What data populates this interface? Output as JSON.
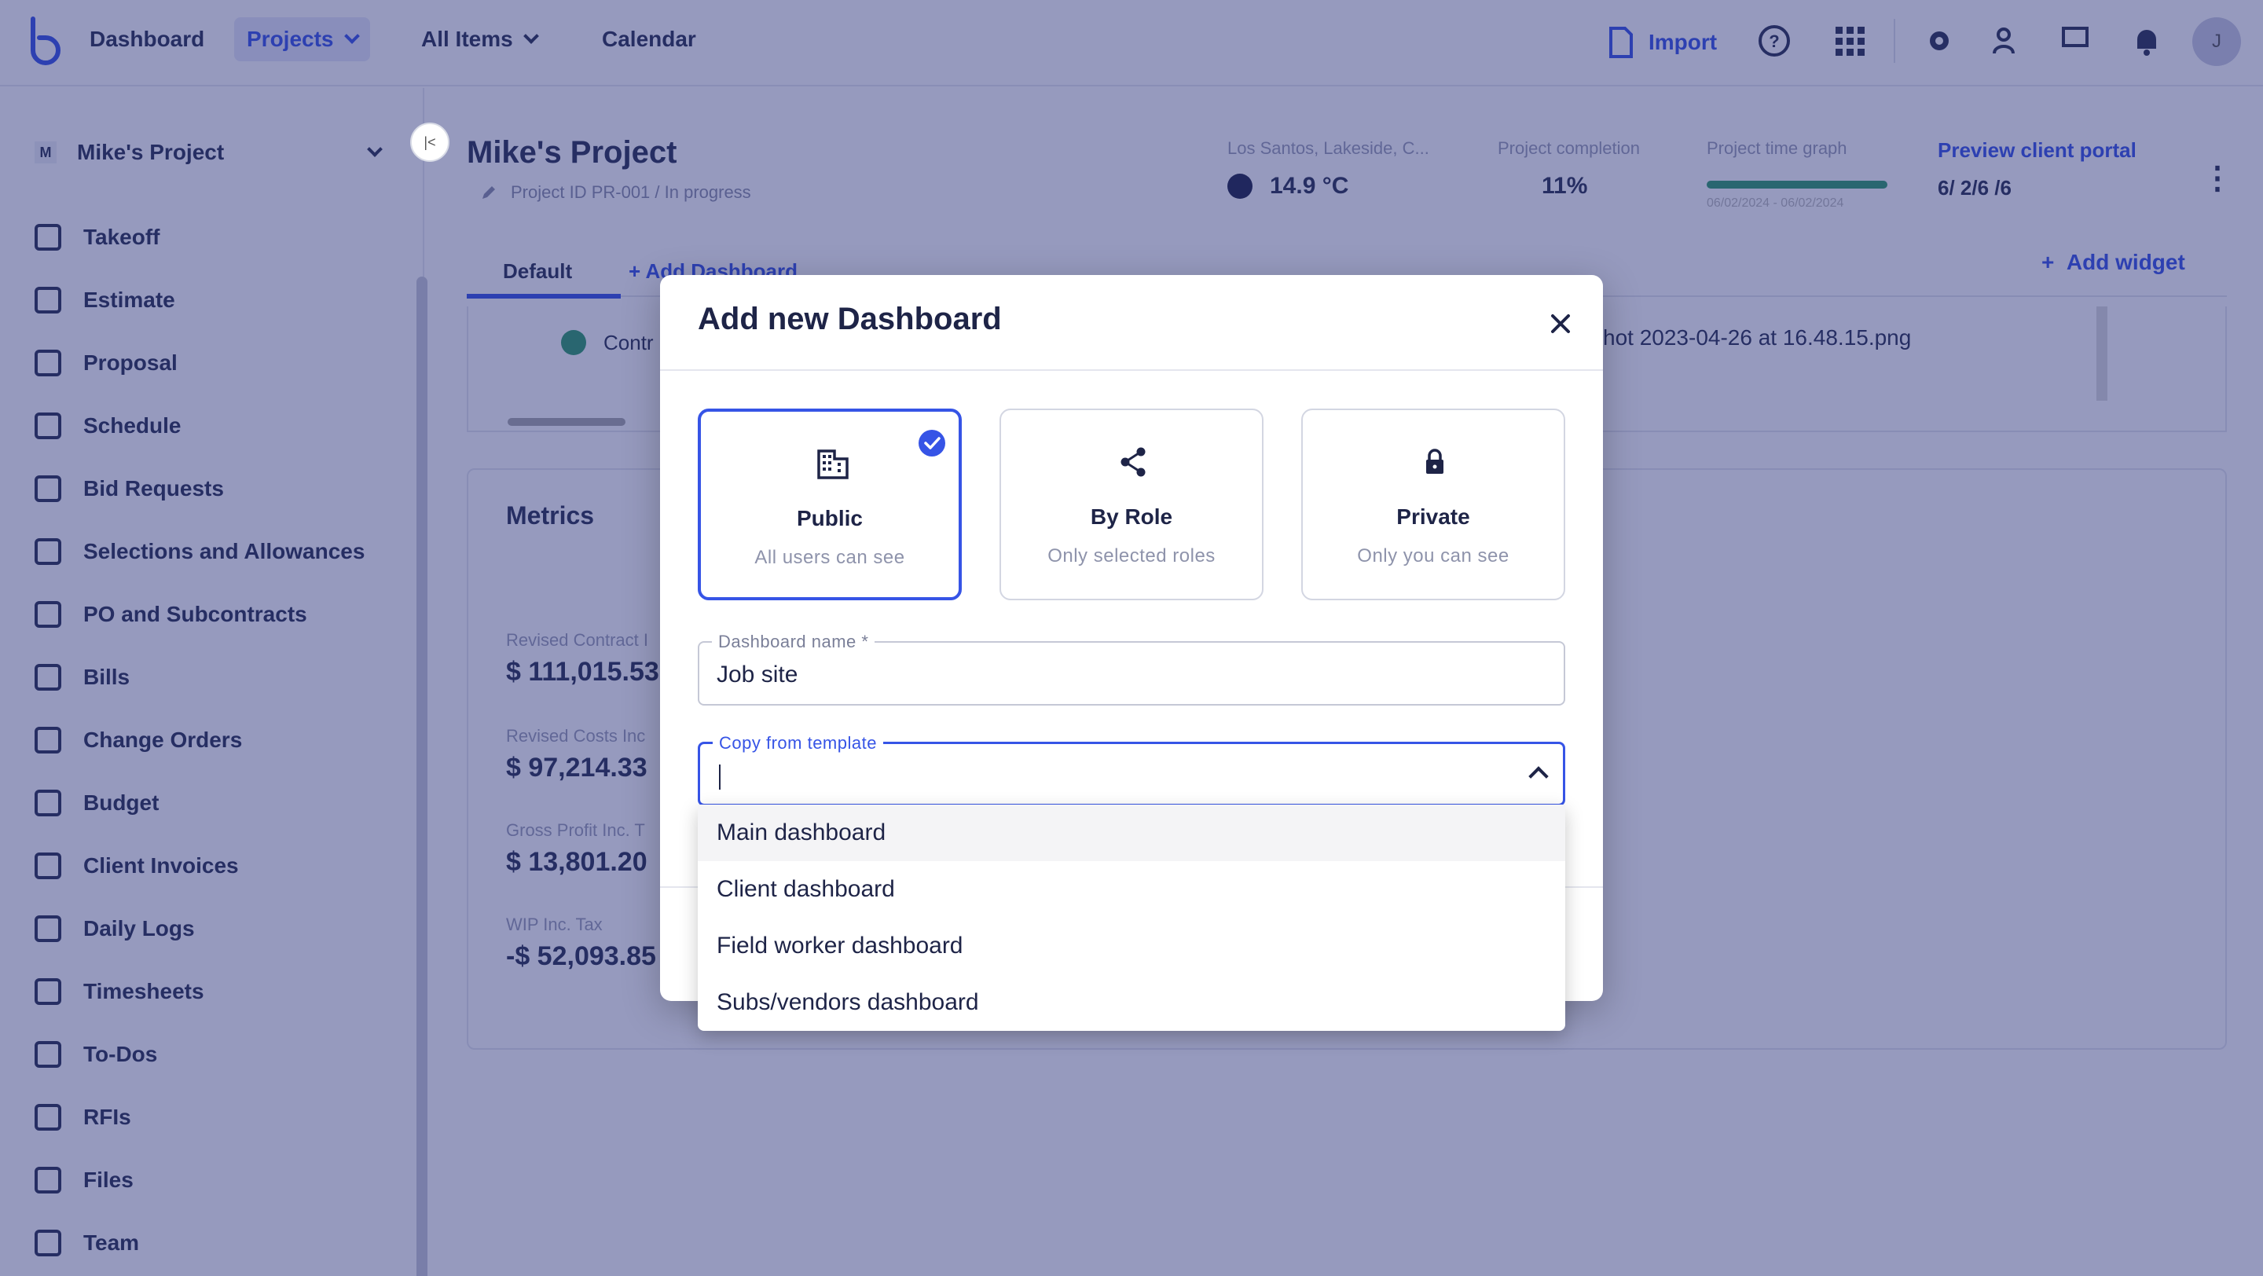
{
  "topbar": {
    "nav": [
      "Dashboard",
      "Projects",
      "All Items",
      "Calendar"
    ],
    "import_label": "Import",
    "avatar_initial": "J"
  },
  "sidebar": {
    "project_name": "Mike's Project",
    "project_badge": "M",
    "collapse_label": "|<",
    "items": [
      "Takeoff",
      "Estimate",
      "Proposal",
      "Schedule",
      "Bid Requests",
      "Selections and Allowances",
      "PO and Subcontracts",
      "Bills",
      "Change Orders",
      "Budget",
      "Client Invoices",
      "Daily Logs",
      "Timesheets",
      "To-Dos",
      "RFIs",
      "Files",
      "Team"
    ]
  },
  "project_header": {
    "title": "Mike's Project",
    "subtitle": "Project ID PR-001 / In progress",
    "location_label": "Los Santos, Lakeside, C...",
    "temperature": "14.9 °C",
    "completion_label": "Project completion",
    "completion_value": "11%",
    "time_graph_label": "Project time graph",
    "time_graph_dates": "06/02/2024 - 06/02/2024",
    "preview_label": "Preview client portal",
    "preview_code": "6/ 2/6 /6",
    "kebab": "⋮"
  },
  "dashboard_tabs": {
    "default_label": "Default",
    "add_dashboard_label": "Add Dashboard",
    "add_widget_label": "Add widget"
  },
  "card1": {
    "item_label": "Contr",
    "file_name": "hot 2023-04-26 at 16.48.15.png"
  },
  "metrics": {
    "title": "Metrics",
    "items": [
      {
        "label": "Revised Contract I",
        "value": "$ 111,015.53"
      },
      {
        "label": "Revised Costs Inc",
        "value": "$ 97,214.33"
      },
      {
        "label": "Gross Profit Inc. T",
        "value": "$ 13,801.20"
      },
      {
        "label": "WIP Inc. Tax",
        "value": "-$ 52,093.85"
      }
    ]
  },
  "dialog": {
    "title": "Add new Dashboard",
    "visibility_options": [
      {
        "icon": "building-icon",
        "title": "Public",
        "subtitle": "All users can see",
        "selected": true
      },
      {
        "icon": "share-icon",
        "title": "By Role",
        "subtitle": "Only selected roles",
        "selected": false
      },
      {
        "icon": "lock-icon",
        "title": "Private",
        "subtitle": "Only you can see",
        "selected": false
      }
    ],
    "name_field": {
      "label": "Dashboard name *",
      "value": "Job site"
    },
    "template_field": {
      "label": "Copy from template",
      "value": ""
    },
    "template_options": [
      "Main dashboard",
      "Client dashboard",
      "Field worker dashboard",
      "Subs/vendors dashboard"
    ],
    "colors": {
      "accent": "#3654e6",
      "text": "#1e2447",
      "muted": "#8e93ab"
    }
  }
}
